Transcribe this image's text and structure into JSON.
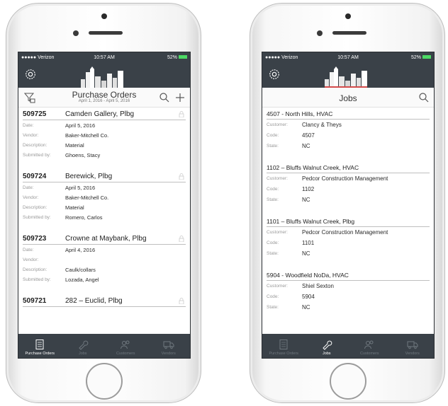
{
  "colors": {
    "header": "#3a4148",
    "accent_red": "#d44b4b",
    "battery": "#4cd964"
  },
  "left_phone": {
    "status": {
      "carrier": "●●●●● Verizon",
      "time": "10:57 AM",
      "battery": "52%"
    },
    "title": "Purchase Orders",
    "subtitle": "April 1, 2016 - April 5, 2016",
    "orders": [
      {
        "number": "509725",
        "name": "Camden Gallery, Plbg",
        "date": "April 5, 2016",
        "vendor": "Baker-Mitchell Co.",
        "description": "Material",
        "submitted_by": "Ghoens, Stacy"
      },
      {
        "number": "509724",
        "name": "Berewick, Plbg",
        "date": "April 5, 2016",
        "vendor": "Baker-Mitchell Co.",
        "description": "Material",
        "submitted_by": "Romero, Carlos"
      },
      {
        "number": "509723",
        "name": "Crowne at Maybank, Plbg",
        "date": "April 4, 2016",
        "vendor": "",
        "description": "Caulk/collars",
        "submitted_by": "Lozada, Angel"
      },
      {
        "number": "509721",
        "name": "282 – Euclid, Plbg"
      }
    ],
    "labels": {
      "date": "Date:",
      "vendor": "Vendor:",
      "description": "Description:",
      "submitted_by": "Submitted by:"
    },
    "tabs": [
      "Purchase Orders",
      "Jobs",
      "Customers",
      "Vendors"
    ]
  },
  "right_phone": {
    "status": {
      "carrier": "●●●●● Verizon",
      "time": "10:57 AM",
      "battery": "52%"
    },
    "title": "Jobs",
    "jobs": [
      {
        "title": "4507 - North Hills, HVAC",
        "customer": "Clancy & Theys",
        "code": "4507",
        "state": "NC"
      },
      {
        "title": "1102 – Bluffs Walnut Creek, HVAC",
        "customer": "Pedcor Construction Management",
        "code": "1102",
        "state": "NC"
      },
      {
        "title": "1101 – Bluffs Walnut Creek, Plbg",
        "customer": "Pedcor Construction Management",
        "code": "1101",
        "state": "NC"
      },
      {
        "title": "5904 - Woodfield NoDa, HVAC",
        "customer": "Shiel Sexton",
        "code": "5904",
        "state": "NC"
      }
    ],
    "labels": {
      "customer": "Customer:",
      "code": "Code:",
      "state": "State:"
    },
    "tabs": [
      "Purchase Orders",
      "Jobs",
      "Customers",
      "Vendors"
    ]
  }
}
